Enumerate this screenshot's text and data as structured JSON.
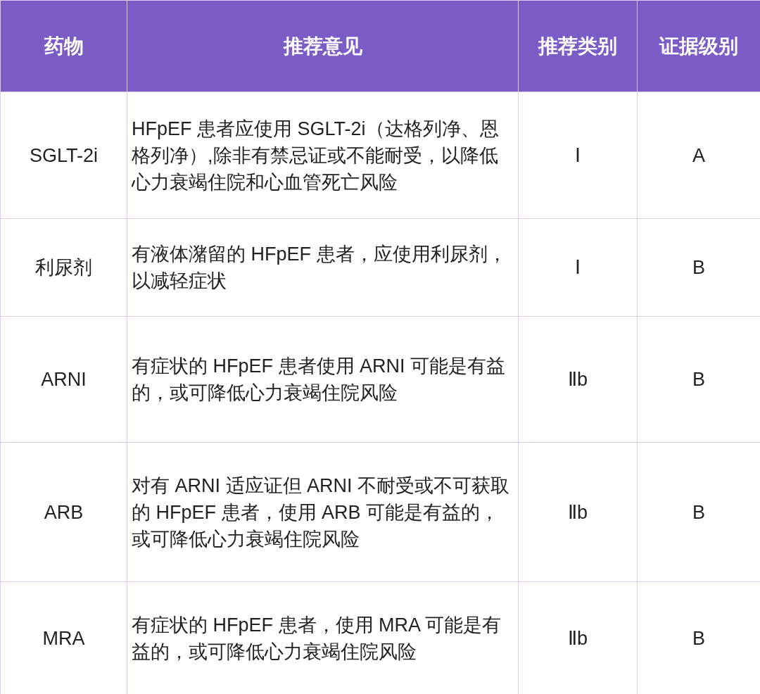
{
  "table": {
    "columns": [
      "药物",
      "推荐意见",
      "推荐类别",
      "证据级别"
    ],
    "rows": [
      {
        "cells": [
          "SGLT-2i",
          "HFpEF 患者应使用 SGLT-2i（达格列净、恩格列净）,除非有禁忌证或不能耐受，以降低心力衰竭住院和心血管死亡风险",
          "Ⅰ",
          "A"
        ]
      },
      {
        "cells": [
          "利尿剂",
          "有液体潴留的 HFpEF 患者，应使用利尿剂，以减轻症状",
          "Ⅰ",
          "B"
        ]
      },
      {
        "cells": [
          "ARNI",
          "有症状的 HFpEF 患者使用 ARNI 可能是有益的，或可降低心力衰竭住院风险",
          "Ⅱb",
          "B"
        ]
      },
      {
        "cells": [
          "ARB",
          "对有 ARNI 适应证但 ARNI 不耐受或不可获取的 HFpEF 患者，使用 ARB 可能是有益的，或可降低心力衰竭住院风险",
          "Ⅱb",
          "B"
        ]
      },
      {
        "cells": [
          "MRA",
          "有症状的 HFpEF 患者，使用 MRA 可能是有益的，或可降低心力衰竭住院风险",
          "Ⅱb",
          "B"
        ]
      }
    ]
  }
}
